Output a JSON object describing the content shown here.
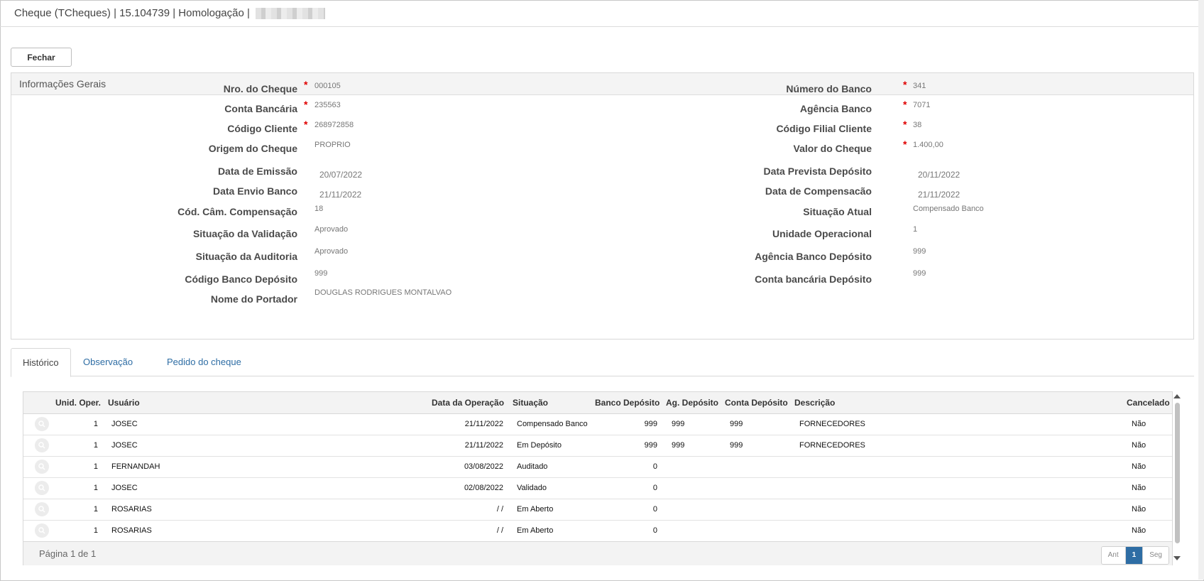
{
  "window": {
    "title": "Cheque (TCheques) | 15.104739 | Homologação |"
  },
  "toolbar": {
    "close_label": "Fechar"
  },
  "panel": {
    "title": "Informações Gerais",
    "left": [
      {
        "label": "Nro. do Cheque",
        "value": "000105",
        "required": true
      },
      {
        "label": "Conta Bancária",
        "value": "235563",
        "required": true
      },
      {
        "label": "Código Cliente",
        "value": "268972858",
        "required": true
      },
      {
        "label": "Origem do Cheque",
        "value": "PROPRIO",
        "required": false
      },
      {
        "label": "Data de Emissão",
        "value": "20/07/2022",
        "required": false
      },
      {
        "label": "Data Envio Banco",
        "value": "21/11/2022",
        "required": false
      },
      {
        "label": "Cód. Câm. Compensação",
        "value": "18",
        "required": false
      },
      {
        "label": "Situação da Validação",
        "value": "Aprovado",
        "required": false
      },
      {
        "label": "Situação da Auditoria",
        "value": "Aprovado",
        "required": false
      },
      {
        "label": "Código Banco Depósito",
        "value": "999",
        "required": false
      },
      {
        "label": "Nome do Portador",
        "value": "DOUGLAS RODRIGUES MONTALVAO",
        "required": false
      }
    ],
    "right": [
      {
        "label": "Número do Banco",
        "value": "341",
        "required": true
      },
      {
        "label": "Agência Banco",
        "value": "7071",
        "required": true
      },
      {
        "label": "Código Filial Cliente",
        "value": "38",
        "required": true
      },
      {
        "label": "Valor do Cheque",
        "value": "1.400,00",
        "required": true
      },
      {
        "label": "Data Prevista Depósito",
        "value": "20/11/2022",
        "required": false
      },
      {
        "label": "Data de Compensacão",
        "value": "21/11/2022",
        "required": false
      },
      {
        "label": "Situação Atual",
        "value": "Compensado Banco",
        "required": false
      },
      {
        "label": "Unidade Operacional",
        "value": "1",
        "required": false
      },
      {
        "label": "Agência Banco Depósito",
        "value": "999",
        "required": false
      },
      {
        "label": "Conta bancária Depósito",
        "value": "999",
        "required": false
      }
    ]
  },
  "tabs": [
    {
      "label": "Histórico",
      "active": true
    },
    {
      "label": "Observação",
      "active": false
    },
    {
      "label": "Pedido do cheque",
      "active": false
    }
  ],
  "grid": {
    "columns": [
      "Unid. Oper.",
      "Usuário",
      "Data da Operação",
      "Situação",
      "Banco Depósito",
      "Ag. Depósito",
      "Conta Depósito",
      "Descrição",
      "Cancelado"
    ],
    "rows": [
      [
        "1",
        "JOSEC",
        "21/11/2022",
        "Compensado Banco",
        "999",
        "999",
        "999",
        "FORNECEDORES",
        "Não"
      ],
      [
        "1",
        "JOSEC",
        "21/11/2022",
        "Em Depósito",
        "999",
        "999",
        "999",
        "FORNECEDORES",
        "Não"
      ],
      [
        "1",
        "FERNANDAH",
        "03/08/2022",
        "Auditado",
        "0",
        "",
        "",
        "",
        "Não"
      ],
      [
        "1",
        "JOSEC",
        "02/08/2022",
        "Validado",
        "0",
        "",
        "",
        "",
        "Não"
      ],
      [
        "1",
        "ROSARIAS",
        "/ /",
        "Em Aberto",
        "0",
        "",
        "",
        "",
        "Não"
      ],
      [
        "1",
        "ROSARIAS",
        "/ /",
        "Em Aberto",
        "0",
        "",
        "",
        "",
        "Não"
      ]
    ],
    "page_info": "Página 1 de 1",
    "pager": {
      "prev": "Ant",
      "current": "1",
      "next": "Seg"
    }
  },
  "colors": {
    "accent": "#2e6da4",
    "required": "#e00000"
  },
  "icons": {
    "row_action": "search-icon"
  }
}
